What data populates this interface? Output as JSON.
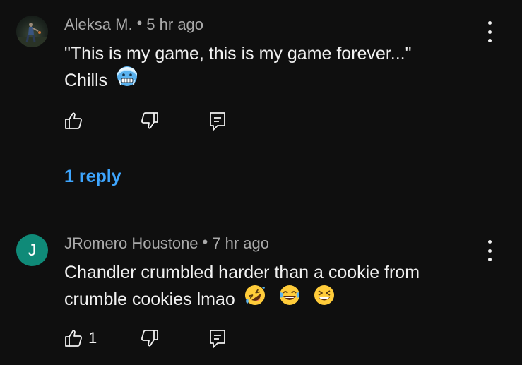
{
  "comments": [
    {
      "author": "Aleksa M.",
      "separator": "•",
      "time": "5 hr ago",
      "text_line1": "\"This is my game, this is my game forever...\"",
      "text_line2": "Chills",
      "emojis": [
        "cold-face"
      ],
      "like_count": "",
      "replies_label": "1 reply"
    },
    {
      "author": "JRomero Houstone",
      "avatar_letter": "J",
      "avatar_color": "#0f8a78",
      "separator": "•",
      "time": "7 hr ago",
      "text_line1": "Chandler crumbled harder than a cookie from",
      "text_line2": "crumble cookies lmao",
      "emojis": [
        "rolling-on-floor-laughing",
        "tears-of-joy",
        "grinning-squinting"
      ],
      "like_count": "1"
    }
  ],
  "colors": {
    "background": "#0f0f0f",
    "text": "#f1f1f1",
    "meta": "#aaaaaa",
    "link": "#3ea6ff"
  }
}
